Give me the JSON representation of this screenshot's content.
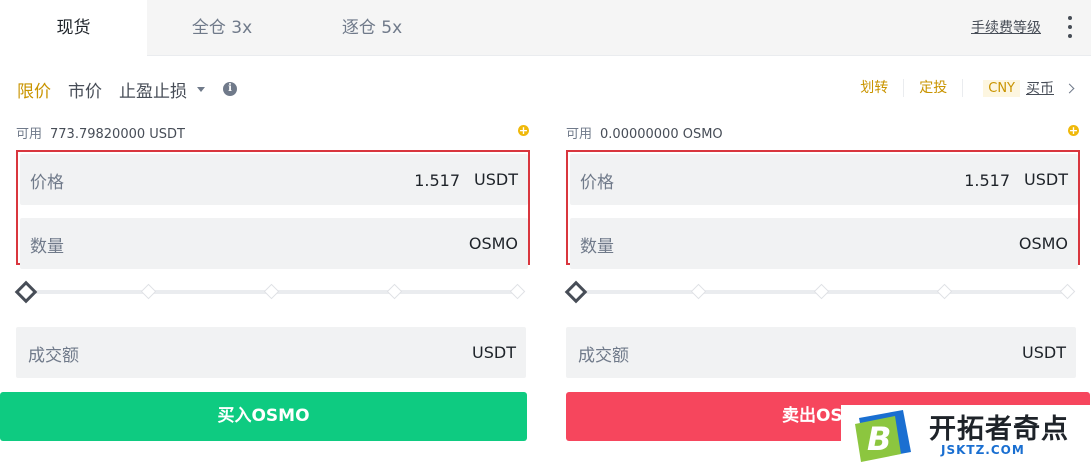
{
  "tabs": [
    {
      "label": "现货"
    },
    {
      "label": "全仓 3x"
    },
    {
      "label": "逐仓 5x"
    }
  ],
  "fee_link": "手续费等级",
  "order_types": [
    {
      "label": "限价"
    },
    {
      "label": "市价"
    },
    {
      "label": "止盈止损"
    }
  ],
  "top_links": {
    "transfer": "划转",
    "auto_invest": "定投",
    "currency": "CNY",
    "buy_coin": "买币"
  },
  "buy": {
    "available_label": "可用",
    "available_value": "773.79820000 USDT",
    "price_label": "价格",
    "price_value": "1.517",
    "price_unit": "USDT",
    "qty_label": "数量",
    "qty_unit": "OSMO",
    "total_label": "成交额",
    "total_unit": "USDT",
    "button_label": "买入OSMO"
  },
  "sell": {
    "available_label": "可用",
    "available_value": "0.00000000 OSMO",
    "price_label": "价格",
    "price_value": "1.517",
    "price_unit": "USDT",
    "qty_label": "数量",
    "qty_unit": "OSMO",
    "total_label": "成交额",
    "total_unit": "USDT",
    "button_label": "卖出OSMO"
  },
  "watermark": {
    "title": "开拓者奇点",
    "subtitle": "JSKTZ.COM"
  },
  "colors": {
    "accent": "#c99400",
    "buy": "#0ecb81",
    "sell": "#f6465d",
    "highlight_box": "#d9363e"
  }
}
